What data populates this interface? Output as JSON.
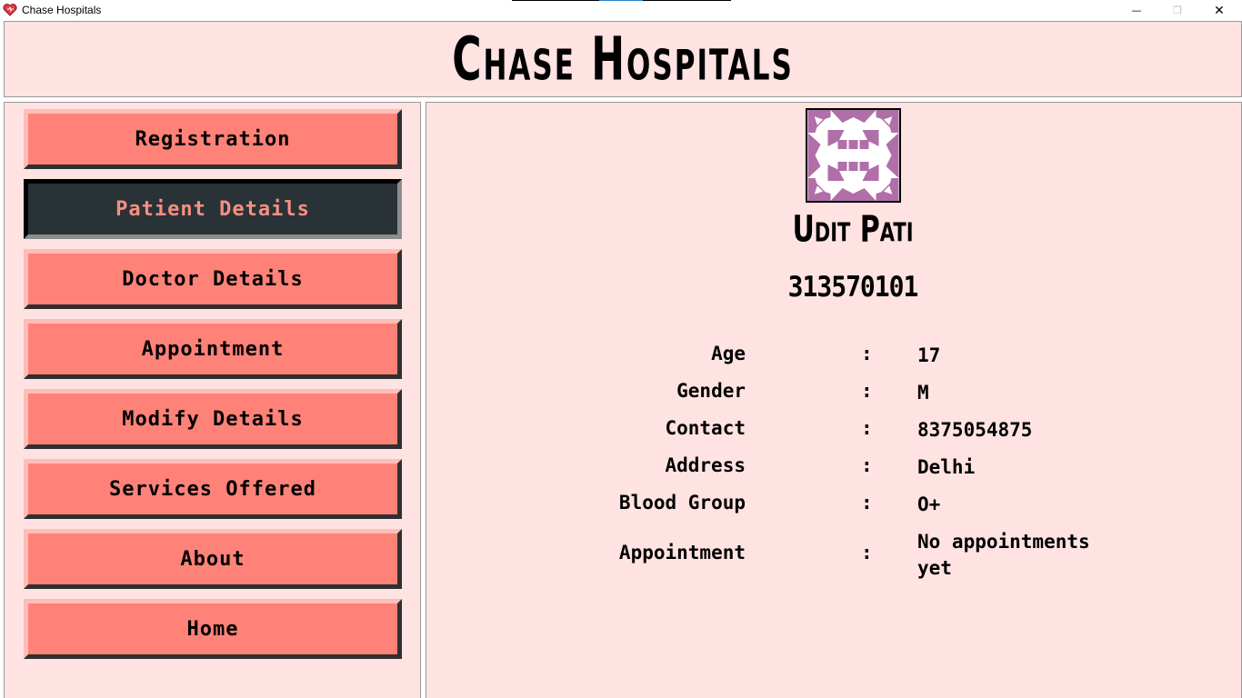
{
  "window": {
    "title": "Chase Hospitals",
    "minimize": "—",
    "maximize": "❐",
    "close": "✕"
  },
  "header": {
    "title": "Chase Hospitals"
  },
  "sidebar": {
    "items": [
      {
        "label": "Registration",
        "active": false
      },
      {
        "label": "Patient Details",
        "active": true
      },
      {
        "label": "Doctor Details",
        "active": false
      },
      {
        "label": "Appointment",
        "active": false
      },
      {
        "label": "Modify Details",
        "active": false
      },
      {
        "label": "Services Offered",
        "active": false
      },
      {
        "label": "About",
        "active": false
      },
      {
        "label": "Home",
        "active": false
      }
    ]
  },
  "patient": {
    "name": "Udit Pati",
    "id": "313570101",
    "avatar_color": "#b06fa8",
    "fields": [
      {
        "label": "Age",
        "colon": ":",
        "value": "17"
      },
      {
        "label": "Gender",
        "colon": ":",
        "value": "M"
      },
      {
        "label": "Contact",
        "colon": ":",
        "value": "8375054875"
      },
      {
        "label": "Address",
        "colon": ":",
        "value": "Delhi"
      },
      {
        "label": "Blood Group",
        "colon": ":",
        "value": "O+"
      },
      {
        "label": "Appointment",
        "colon": ":",
        "value": "No appointments yet"
      }
    ]
  },
  "colors": {
    "background": "#ffe3e3",
    "button": "#ff8278",
    "button_active": "#293237",
    "button_active_text": "#f59080"
  }
}
